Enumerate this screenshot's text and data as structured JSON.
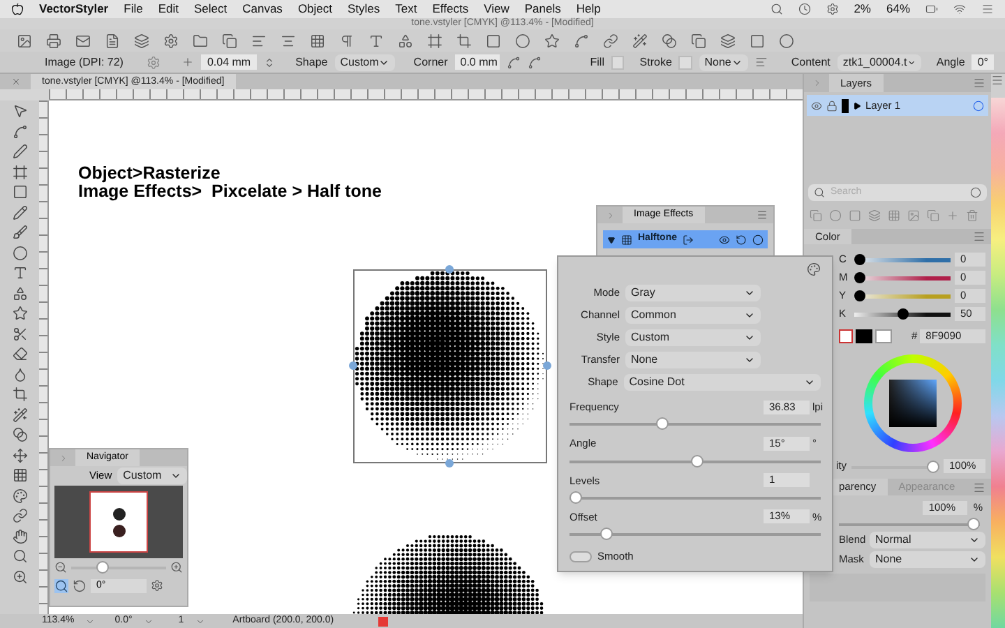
{
  "menu_bar": {
    "app": "VectorStyler",
    "items": [
      "File",
      "Edit",
      "Select",
      "Canvas",
      "Object",
      "Styles",
      "Text",
      "Effects",
      "View",
      "Panels",
      "Help"
    ],
    "status": [
      "2%",
      "64%"
    ]
  },
  "window": {
    "title": "tone.vstyler [CMYK] @113.4% - [Modified]"
  },
  "control_bar": {
    "object": "Image (DPI: 72)",
    "size": "0.04 mm",
    "shape_label": "Shape",
    "shape": "Custom",
    "corner_label": "Corner",
    "corner": "0.0 mm",
    "fill_label": "Fill",
    "stroke_label": "Stroke",
    "stroke_style": "None",
    "content_label": "Content",
    "content": "ztk1_00004.t",
    "angle_label": "Angle",
    "angle": "0°"
  },
  "document_tab": {
    "title": "tone.vstyler [CMYK] @113.4% - [Modified]"
  },
  "canvas": {
    "notes": [
      "Object>Rasterize",
      "Image Effects>  Pixcelate > Half tone"
    ]
  },
  "image_effects": {
    "title": "Image Effects",
    "effect": {
      "name": "Halftone",
      "expanded": true
    },
    "selects": [
      {
        "label": "Mode",
        "value": "Gray",
        "wide": false
      },
      {
        "label": "Channel",
        "value": "Common",
        "wide": false
      },
      {
        "label": "Style",
        "value": "Custom",
        "wide": false
      },
      {
        "label": "Transfer",
        "value": "None",
        "wide": false
      },
      {
        "label": "Shape",
        "value": "Cosine Dot",
        "wide": true
      }
    ],
    "sliders": [
      {
        "label": "Frequency",
        "value": "36.83",
        "unit": "lpi",
        "level": 0.36
      },
      {
        "label": "Angle",
        "value": "15°",
        "unit": "°",
        "level": 0.51
      },
      {
        "label": "Levels",
        "value": "1",
        "level": 0
      },
      {
        "label": "Offset",
        "value": "13%",
        "unit": "%",
        "level": 0.13
      }
    ],
    "smooth": {
      "label": "Smooth",
      "on": false
    }
  },
  "navigator": {
    "title": "Navigator",
    "view_label": "View",
    "view": "Custom",
    "level": 0.3,
    "angle": "0°"
  },
  "layers": {
    "title": "Layers",
    "items": [
      {
        "name": "Layer 1",
        "selected": true
      }
    ],
    "search_placeholder": "Search"
  },
  "color": {
    "title": "Color",
    "channels": [
      {
        "name": "C",
        "value": "0",
        "level": 0,
        "color": "#2f6fa8"
      },
      {
        "name": "M",
        "value": "0",
        "level": 0,
        "color": "#b0204a"
      },
      {
        "name": "Y",
        "value": "0",
        "level": 0,
        "color": "#b8a020"
      },
      {
        "name": "K",
        "value": "50",
        "level": 0.5,
        "color": "#111111"
      }
    ],
    "hex_label": "#",
    "hex": "8F9090",
    "opacity": {
      "label": "ity",
      "value": "100%",
      "level": 1
    }
  },
  "transparency": {
    "tabs": [
      {
        "label": "parency",
        "selected": true
      },
      {
        "label": "Appearance",
        "selected": false
      }
    ],
    "opacity": "100%",
    "unit": "%",
    "level": 1,
    "blend_label": "Blend",
    "blend": "Normal",
    "mask_label": "Mask",
    "mask": "None"
  },
  "status_bar": {
    "zoom": "113.4%",
    "rotation": "0.0°",
    "page": "1",
    "artboard": "Artboard (200.0, 200.0)"
  }
}
